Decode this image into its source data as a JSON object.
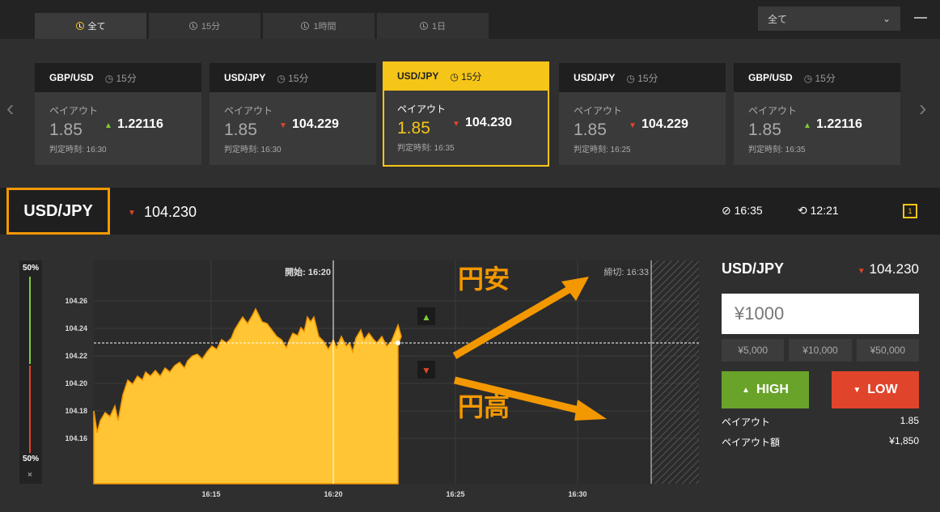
{
  "tabs": [
    {
      "label": "全て",
      "active": true
    },
    {
      "label": "15分"
    },
    {
      "label": "1時間"
    },
    {
      "label": "1日"
    }
  ],
  "filter": {
    "selected": "全て"
  },
  "cards": [
    {
      "pair": "GBP/USD",
      "period": "15分",
      "payout_label": "ペイアウト",
      "payout": "1.85",
      "direction": "up",
      "price": "1.22116",
      "judge": "判定時刻: 16:30"
    },
    {
      "pair": "USD/JPY",
      "period": "15分",
      "payout_label": "ペイアウト",
      "payout": "1.85",
      "direction": "down",
      "price": "104.229",
      "judge": "判定時刻: 16:30"
    },
    {
      "pair": "USD/JPY",
      "period": "15分",
      "payout_label": "ペイアウト",
      "payout": "1.85",
      "direction": "down",
      "price": "104.230",
      "judge": "判定時刻: 16:35",
      "selected": true
    },
    {
      "pair": "USD/JPY",
      "period": "15分",
      "payout_label": "ペイアウト",
      "payout": "1.85",
      "direction": "down",
      "price": "104.229",
      "judge": "判定時刻: 16:25"
    },
    {
      "pair": "GBP/USD",
      "period": "15分",
      "payout_label": "ペイアウト",
      "payout": "1.85",
      "direction": "up",
      "price": "1.22116",
      "judge": "判定時刻: 16:35"
    }
  ],
  "info": {
    "symbol": "USD/JPY",
    "price": "104.230",
    "expiry": "16:35",
    "remaining": "12:21",
    "chart_icon_label": "1"
  },
  "sentiment": {
    "top": "50%",
    "bottom": "50%",
    "close": "×",
    "up_share": 0.5,
    "down_share": 0.5
  },
  "chart": {
    "start_label": "開始: 16:20",
    "end_label": "締切: 16:33",
    "yticks": [
      "104.26",
      "104.24",
      "104.22",
      "104.20",
      "104.18",
      "104.16"
    ],
    "xticks": [
      "16:15",
      "16:20",
      "16:25",
      "16:30"
    ],
    "current": 104.23
  },
  "annotations": {
    "weak_yen": "円安",
    "strong_yen": "円高"
  },
  "panel": {
    "symbol": "USD/JPY",
    "price": "104.230",
    "amount": "¥1000",
    "quick": [
      "¥5,000",
      "¥10,000",
      "¥50,000"
    ],
    "high": "HIGH",
    "low": "LOW",
    "payout_label": "ペイアウト",
    "payout": "1.85",
    "payout_amount_label": "ペイアウト額",
    "payout_amount": "¥1,850"
  },
  "colors": {
    "accent": "#f5c518",
    "up": "#7fcd39",
    "down": "#e0452b",
    "annotation": "#f39800"
  }
}
